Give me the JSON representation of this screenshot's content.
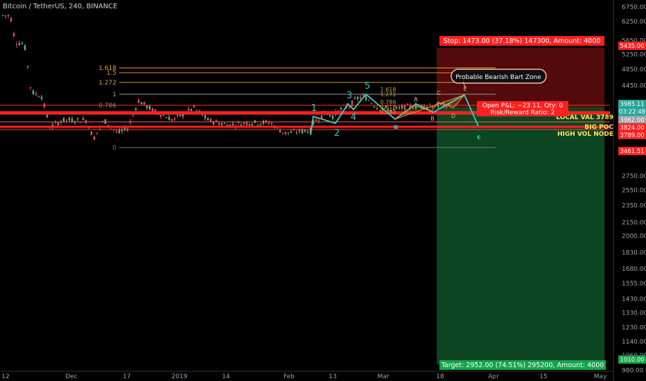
{
  "header": {
    "title": "Bitcoin / TetherUS, 240, BINANCE"
  },
  "chart_data": {
    "type": "candlestick",
    "title": "Bitcoin / TetherUS, 240, BINANCE",
    "y_axis": {
      "scale": "log",
      "tick_labels": [
        6750.0,
        6250.0,
        5650.0,
        5250.0,
        4850.0,
        4450.0,
        3600.0,
        2750.0,
        2550.0,
        2350.0,
        2150.0,
        2000.0,
        1830.0,
        1680.0,
        1555.0,
        1430.0,
        1330.0,
        1230.0,
        1140.0,
        1060.0,
        980.0
      ]
    },
    "x_axis": {
      "tick_labels": [
        "12",
        "Dec",
        "17",
        "2019",
        "14",
        "Feb",
        "13",
        "Mar",
        "18",
        "Apr",
        "15",
        "May"
      ]
    },
    "price_tags": [
      {
        "value": "5435.00",
        "color": "#ff1f1f"
      },
      {
        "value": "3985.11",
        "color": "#26a69a"
      },
      {
        "value": "03:22:48",
        "color": "#26a69a"
      },
      {
        "value": "3962.00",
        "color": "#9aa0a8"
      },
      {
        "value": "3824.00",
        "color": "#ff1f1f"
      },
      {
        "value": "3789.00",
        "color": "#ff1f1f"
      },
      {
        "value": "3461.51",
        "color": "#ff1f1f"
      },
      {
        "value": "1010.00",
        "color": "#16a34a"
      }
    ],
    "fib_levels": [
      "0",
      "0.786",
      "1",
      "1.272",
      "1.5",
      "1.618"
    ],
    "fib_levels_small": [
      "1.618",
      "1.272",
      "0.786",
      "0.618",
      "0.382"
    ],
    "wave_labels": [
      "1",
      "2",
      "3",
      "4",
      "5",
      "a",
      "c"
    ],
    "pattern_labels": [
      "A",
      "B",
      "C",
      "D",
      "E"
    ],
    "horizontal_labels": [
      "LOCAL VAL 3789",
      "BIG POC",
      "HIGH VOL NODE"
    ],
    "annotations": {
      "stop": "Stop: 1473.00 (37.18%) 147300, Amount: 4000",
      "target": "Target: 2952.00 (74.51%) 295200, Amount: 4000",
      "pnl_line1": "Open P&L: −23.11, Qty: 0",
      "pnl_line2": "Risk/Reward Ratio: 2",
      "bubble": "Probable Bearish Bart Zone"
    }
  }
}
